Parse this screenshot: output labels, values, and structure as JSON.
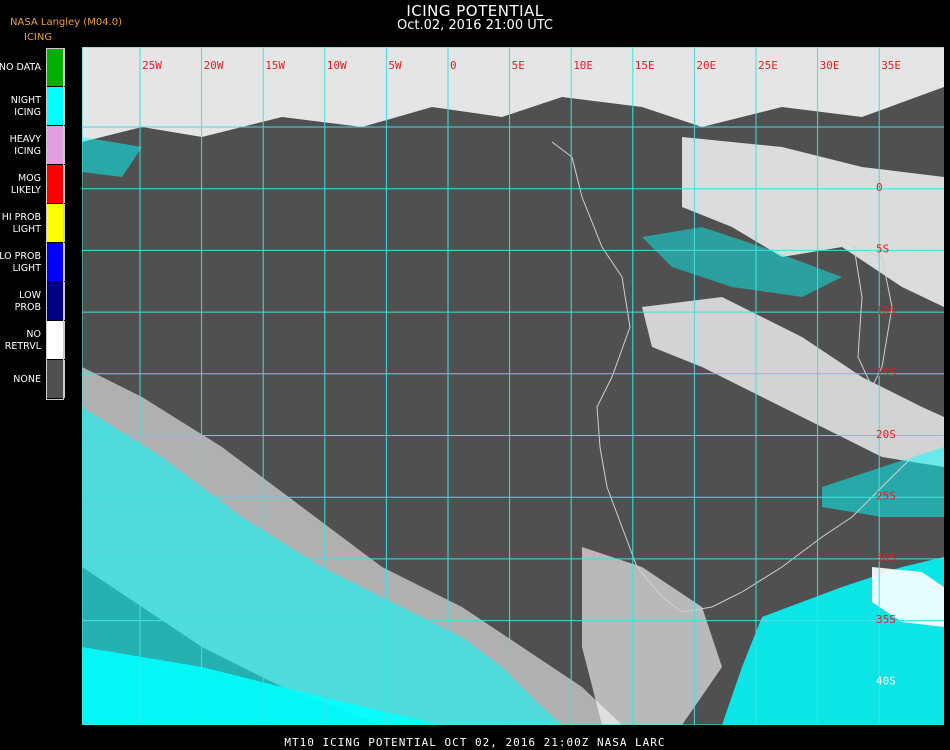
{
  "header": {
    "title": "ICING POTENTIAL",
    "subtitle": "Oct.02, 2016 21:00 UTC",
    "source": "NASA Langley (M04.0)",
    "legend_title": "ICING"
  },
  "legend": [
    {
      "label": "NO DATA",
      "color": "#00b000"
    },
    {
      "label": "NIGHT\nICING",
      "color": "#00ffff"
    },
    {
      "label": "HEAVY\nICING",
      "color": "#e0a0e0"
    },
    {
      "label": "MOG\nLIKELY",
      "color": "#ff0000"
    },
    {
      "label": "HI PROB\nLIGHT",
      "color": "#ffff00"
    },
    {
      "label": "LO PROB\nLIGHT",
      "color": "#0000ff"
    },
    {
      "label": "LOW\nPROB",
      "color": "#000080"
    },
    {
      "label": "NO\nRETRVL",
      "color": "#ffffff"
    },
    {
      "label": "NONE",
      "color": "#505050"
    }
  ],
  "map": {
    "background_color": "#505050",
    "grid_color": "#40e0e0",
    "longitude_labels": [
      "25W",
      "20W",
      "15W",
      "10W",
      "5W",
      "0",
      "5E",
      "10E",
      "15E",
      "20E",
      "25E",
      "30E",
      "35E"
    ],
    "latitude_labels": [
      "0",
      "5S",
      "10S",
      "15S",
      "20S",
      "25S",
      "30S",
      "35S",
      "40S"
    ]
  },
  "footer": {
    "text": "MT10  ICING POTENTIAL   OCT 02, 2016 21:00Z   NASA LARC"
  }
}
